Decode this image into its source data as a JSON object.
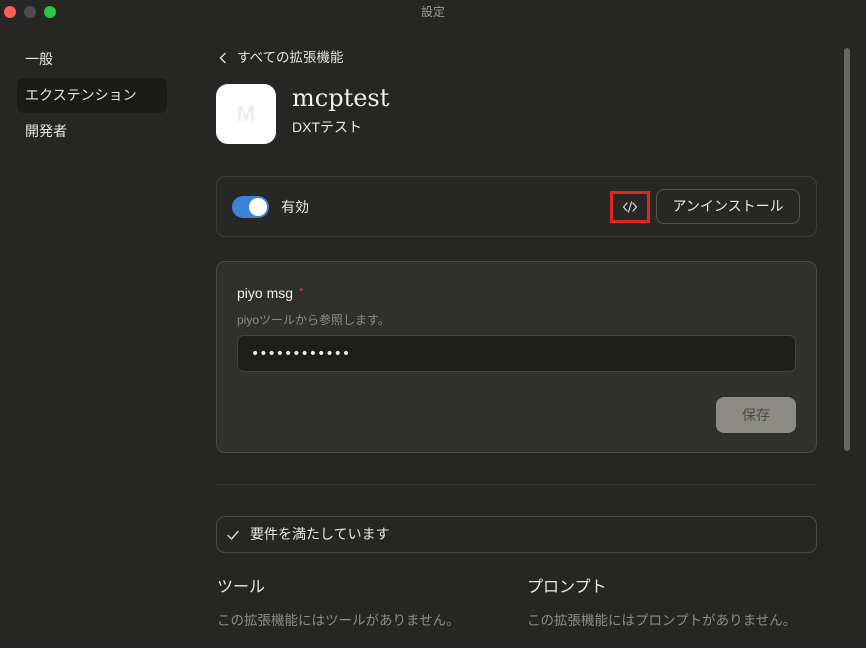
{
  "window": {
    "title": "設定"
  },
  "sidebar": {
    "items": [
      {
        "label": "一般",
        "selected": false
      },
      {
        "label": "エクステンション",
        "selected": true
      },
      {
        "label": "開発者",
        "selected": false
      }
    ]
  },
  "main": {
    "back_link": "すべての拡張機能",
    "extension": {
      "icon_letter": "M",
      "name": "mcptest",
      "subtitle": "DXTテスト"
    },
    "status": {
      "toggle_label": "有効",
      "enabled": true,
      "code_button_highlighted": true,
      "uninstall_label": "アンインストール"
    },
    "config": {
      "fields": [
        {
          "label": "piyo msg",
          "required_mark": "*",
          "help": "piyoツールから参照します。",
          "value": "••••••••••••"
        }
      ],
      "save_label": "保存",
      "save_enabled": false
    },
    "requirements": {
      "met": true,
      "text": "要件を満たしています"
    },
    "sections": [
      {
        "title": "ツール",
        "empty_text": "この拡張機能にはツールがありません。"
      },
      {
        "title": "プロンプト",
        "empty_text": "この拡張機能にはプロンプトがありません。"
      }
    ]
  },
  "icons": {
    "back": "chevron-left-icon",
    "code": "code-icon",
    "requirements": "check-icon"
  },
  "colors": {
    "background": "#262624",
    "accent": "#3b82d8",
    "highlight": "#e3261b",
    "required": "#d04a3c",
    "window_close": "#fe5f57",
    "window_minimize": "#4d4d4f",
    "window_zoom": "#2ac840"
  }
}
